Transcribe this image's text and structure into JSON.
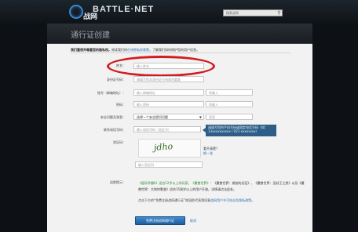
{
  "header": {
    "logo_glyph": "战网",
    "logo_text": "BATTLE·NET",
    "search_placeholder": "搜索战网",
    "search_icon": "magnifier-icon"
  },
  "banner": {
    "title": "通行证创建"
  },
  "intro": {
    "bold": "我们重视并尊重您的隐私权。",
    "text_a": "阅读我们的",
    "link": "在线隐私权政策",
    "text_b": "，了解我们如何保护您的用户信息。"
  },
  "form": {
    "name_label": "姓名：",
    "name_placeholder": "输入姓名",
    "id_label": "身份证号码：",
    "id_placeholder": "请填写您本身份证号码请勿重复",
    "id_hint": "请勿使用他人的身份证号码",
    "account_label": "账号（邮箱地址）：",
    "account_placeholder": "输入邮箱地址",
    "account_confirm_placeholder": "再输入",
    "password_label": "密码：",
    "password_placeholder": "输入密码",
    "password_confirm_placeholder": "再输入",
    "question_label": "安全问题及答案：",
    "question_select": "选择一个安全提问问题",
    "answer_placeholder": "答案",
    "phone_label": "联系电话号码：",
    "phone_placeholder": "输入电话号码（含区号）",
    "phone_tooltip": "请填写您的手机号码或固定电话号码（如：13xxxxxxxxxx / 021-xxxxxxxx）",
    "captcha_label": "验证码：",
    "captcha_text": "jdho",
    "captcha_question": "看不清楚？",
    "captcha_refresh": "换一张",
    "captcha_placeholder": "输入验证码",
    "terms_label": "适龄提示：",
    "terms_text_a": "《星际争霸II》适合12岁以上的玩家。《魔兽世界》：",
    "terms_text_b": "《魔兽世界：燃烧的远征》、《魔兽世界：巫妖王之怒》以及《魔兽世界：大地的裂变》适合15周岁以上的用户开放。详情请点击此处。",
    "terms_note_a": "点击下方的“免费注册战网通行证”按钮即代表我同意",
    "terms_note_link": "战网用户许可协议及隐私政策",
    "terms_note_b": "。",
    "submit_label": "免费注册战网通行证",
    "cancel_label": "取消"
  }
}
